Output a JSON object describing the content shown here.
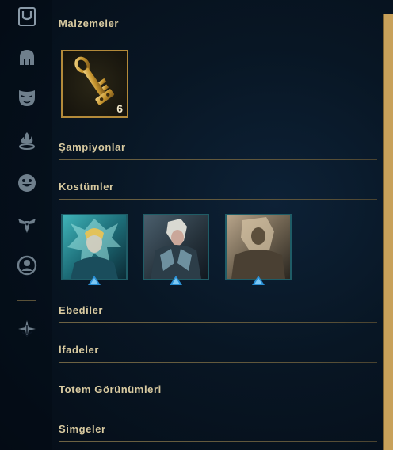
{
  "sidebar": {
    "icons": [
      {
        "name": "inventory-icon"
      },
      {
        "name": "champion-helmet-icon"
      },
      {
        "name": "mask-icon"
      },
      {
        "name": "ward-icon"
      },
      {
        "name": "emote-icon"
      },
      {
        "name": "totem-icon"
      },
      {
        "name": "profile-icon"
      },
      {
        "name": "tft-icon"
      }
    ]
  },
  "sections": {
    "materials": {
      "title": "Malzemeler"
    },
    "champions": {
      "title": "Şampiyonlar"
    },
    "skins": {
      "title": "Kostümler"
    },
    "eternals": {
      "title": "Ebediler"
    },
    "emotes": {
      "title": "İfadeler"
    },
    "ward_skins": {
      "title": "Totem Görünümleri"
    },
    "icons": {
      "title": "Simgeler"
    }
  },
  "materials_items": [
    {
      "name": "key-fragment",
      "count": "6"
    }
  ],
  "colors": {
    "gold": "#c8aa6e",
    "rule": "#6e6343",
    "skin_border": "#1f5c66",
    "gem": "#2a8fd4"
  }
}
